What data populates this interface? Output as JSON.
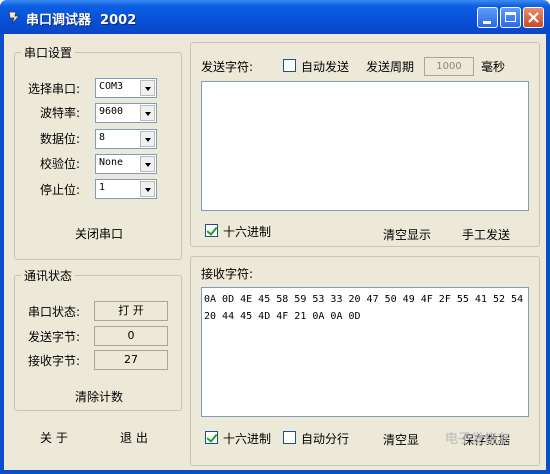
{
  "window": {
    "title": "串口调试器  2002"
  },
  "serial_settings": {
    "title": "串口设置",
    "port": {
      "label": "选择串口:",
      "value": "COM3"
    },
    "baud": {
      "label": "波特率:",
      "value": "9600"
    },
    "databits": {
      "label": "数据位:",
      "value": "8"
    },
    "parity": {
      "label": "校验位:",
      "value": "None"
    },
    "stopbits": {
      "label": "停止位:",
      "value": "1"
    },
    "close_port_label": "关闭串口"
  },
  "comm_status": {
    "title": "通讯状态",
    "port_state": {
      "label": "串口状态:",
      "value": "打 开"
    },
    "sent_bytes": {
      "label": "发送字节:",
      "value": "0"
    },
    "recv_bytes": {
      "label": "接收字节:",
      "value": "27"
    },
    "clear_count_label": "清除计数"
  },
  "footer": {
    "about_label": "关 于",
    "exit_label": "退 出"
  },
  "send": {
    "label": "发送字符:",
    "auto_send_label": "自动发送",
    "period_label": "发送周期",
    "period_value": "1000",
    "period_unit": "毫秒",
    "hex_label": "十六进制",
    "hex_checked": true,
    "clear_label": "清空显示",
    "manual_send_label": "手工发送",
    "text": ""
  },
  "receive": {
    "label": "接收字符:",
    "text": "0A 0D 4E 45 58 59 53 33 20 47 50 49 4F 2F 55 41 52 54 20 44 45 4D 4F 21 0A 0A 0D",
    "hex_label": "十六进制",
    "hex_checked": true,
    "auto_wrap_label": "自动分行",
    "clear_label": "清空显",
    "save_label": "保存数据"
  },
  "watermark": "电子发烧友"
}
